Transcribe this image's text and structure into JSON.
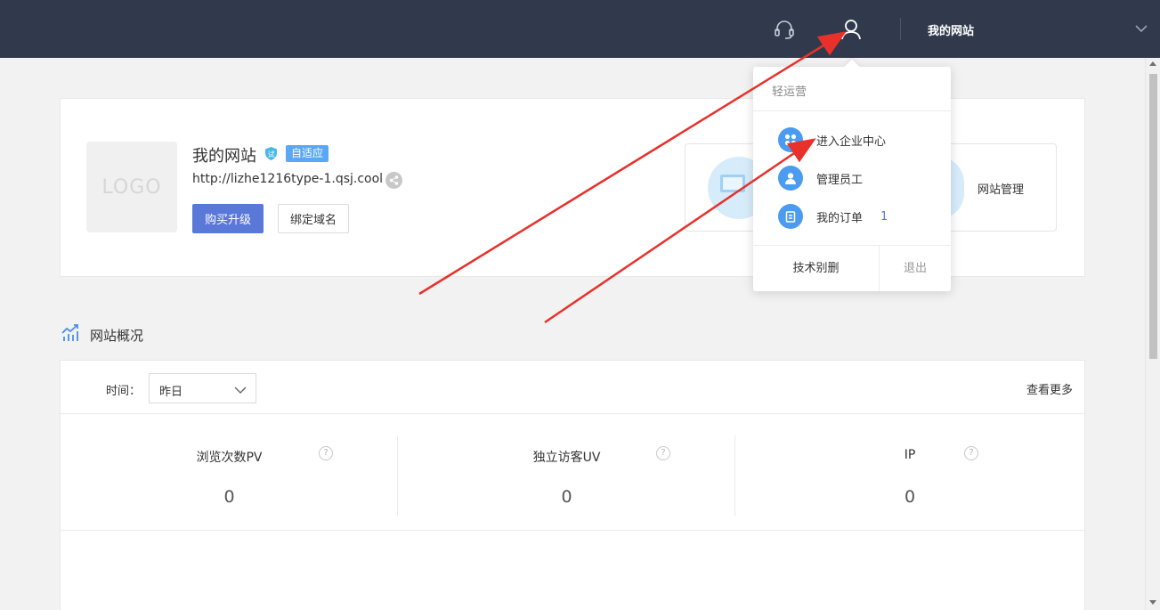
{
  "topbar": {
    "site_name": "我的网站",
    "icons": {
      "support": "headset-icon",
      "user": "user-icon",
      "expand": "chevron-down-icon"
    }
  },
  "site_card": {
    "logo_placeholder": "LOGO",
    "title": "我的网站",
    "trial_badge": "试",
    "adaptive_tag": "自适应",
    "url": "http://lizhe1216type-1.qsj.cool",
    "buy_upgrade": "购买升级",
    "bind_domain": "绑定域名",
    "manage_label": "网站管理"
  },
  "overview": {
    "title": "网站概况",
    "time_label": "时间：",
    "time_value": "昨日",
    "more": "查看更多",
    "stats": [
      {
        "name": "浏览次数PV",
        "value": "0",
        "help": "?"
      },
      {
        "name": "独立访客UV",
        "value": "0",
        "help": "?"
      },
      {
        "name": "IP",
        "value": "0",
        "help": "?"
      }
    ]
  },
  "user_menu": {
    "header": "轻运营",
    "items": [
      {
        "label": "进入企业中心",
        "icon": "grid-icon"
      },
      {
        "label": "管理员工",
        "icon": "person-icon"
      },
      {
        "label": "我的订单",
        "icon": "clipboard-icon",
        "count": "1"
      }
    ],
    "footer_left": "技术别删",
    "footer_right": "退出"
  },
  "colors": {
    "topbar": "#303a4c",
    "primary_button": "#5a78d8",
    "tag": "#5aa8f5",
    "menu_icon": "#4b9bf0",
    "annotation_arrow": "#e8312b"
  }
}
